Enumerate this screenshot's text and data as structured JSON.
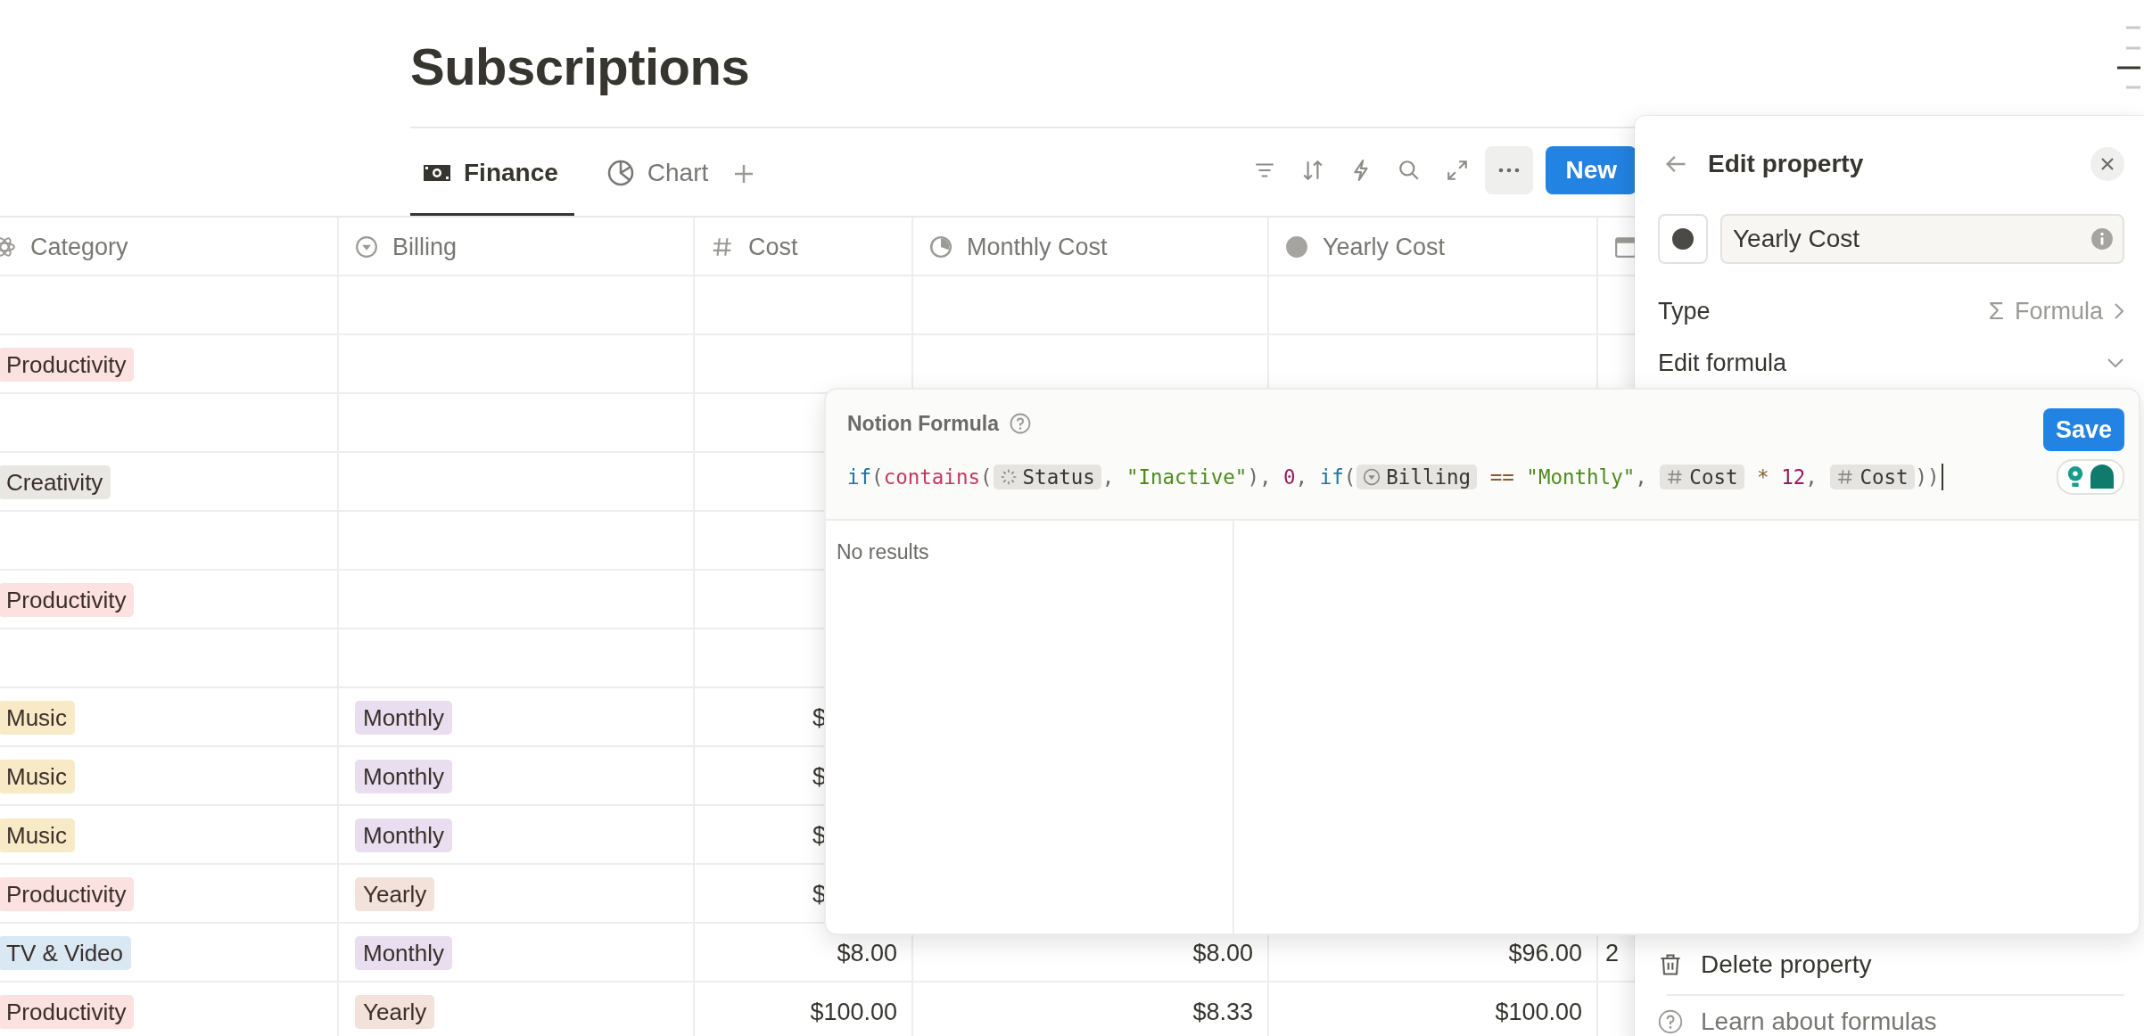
{
  "page": {
    "title": "Subscriptions"
  },
  "tabs": [
    {
      "label": "Finance",
      "kind": "money",
      "selected": true
    },
    {
      "label": "Chart",
      "kind": "chart",
      "selected": false
    }
  ],
  "toolbar": {
    "new_button": "New"
  },
  "table": {
    "columns": [
      {
        "label": "Category",
        "kind": "atom"
      },
      {
        "label": "Billing",
        "kind": "select"
      },
      {
        "label": "Cost",
        "kind": "number"
      },
      {
        "label": "Monthly Cost",
        "kind": "pie"
      },
      {
        "label": "Yearly Cost",
        "kind": "dot"
      },
      {
        "kind": "calendar"
      }
    ],
    "rows": [
      {
        "cells": [
          null,
          null,
          null,
          null,
          null,
          null
        ]
      },
      {
        "cells": [
          {
            "kind": "tag",
            "text": "Productivity",
            "color": "#fbe1df"
          },
          null,
          null,
          null,
          null,
          null
        ]
      },
      {
        "cells": [
          null,
          null,
          null,
          null,
          null,
          null
        ]
      },
      {
        "cells": [
          {
            "kind": "tag",
            "text": "Creativity",
            "color": "#e8e7e4"
          },
          null,
          null,
          null,
          null,
          null
        ]
      },
      {
        "cells": [
          null,
          null,
          null,
          null,
          null,
          null
        ]
      },
      {
        "cells": [
          {
            "kind": "tag",
            "text": "Productivity",
            "color": "#fbe1df"
          },
          null,
          null,
          null,
          null,
          null
        ]
      },
      {
        "cells": [
          null,
          null,
          null,
          null,
          null,
          null
        ]
      },
      {
        "cells": [
          {
            "kind": "tag",
            "text": "Music",
            "color": "#f8eac6"
          },
          {
            "kind": "tag",
            "text": "Monthly",
            "color": "#e8def0"
          },
          {
            "kind": "clipped",
            "text": "$"
          },
          null,
          null,
          null
        ]
      },
      {
        "cells": [
          {
            "kind": "tag",
            "text": "Music",
            "color": "#f8eac6"
          },
          {
            "kind": "tag",
            "text": "Monthly",
            "color": "#e8def0"
          },
          {
            "kind": "clipped",
            "text": "$"
          },
          null,
          null,
          null
        ]
      },
      {
        "cells": [
          {
            "kind": "tag",
            "text": "Music",
            "color": "#f8eac6"
          },
          {
            "kind": "tag",
            "text": "Monthly",
            "color": "#e8def0"
          },
          {
            "kind": "clipped",
            "text": "$"
          },
          null,
          null,
          null
        ]
      },
      {
        "cells": [
          {
            "kind": "tag",
            "text": "Productivity",
            "color": "#fbe1df"
          },
          {
            "kind": "tag",
            "text": "Yearly",
            "color": "#f2e2d9"
          },
          {
            "kind": "clipped",
            "text": "$"
          },
          null,
          null,
          null
        ]
      },
      {
        "cells": [
          {
            "kind": "tag",
            "text": "TV & Video",
            "color": "#d9e8f3"
          },
          {
            "kind": "tag",
            "text": "Monthly",
            "color": "#e8def0"
          },
          {
            "kind": "text",
            "text": "$8.00"
          },
          {
            "kind": "text",
            "text": "$8.00"
          },
          {
            "kind": "text",
            "text": "$96.00"
          },
          {
            "kind": "text",
            "text": "2"
          }
        ]
      },
      {
        "cells": [
          {
            "kind": "tag",
            "text": "Productivity",
            "color": "#fbe1df"
          },
          {
            "kind": "tag",
            "text": "Yearly",
            "color": "#f2e2d9"
          },
          {
            "kind": "text",
            "text": "$100.00"
          },
          {
            "kind": "text",
            "text": "$8.33"
          },
          {
            "kind": "text",
            "text": "$100.00"
          },
          null
        ]
      }
    ]
  },
  "edit_property": {
    "title": "Edit property",
    "name_value": "Yearly Cost",
    "type_label": "Type",
    "type_symbol": "Σ",
    "type_value": "Formula",
    "edit_formula_label": "Edit formula",
    "delete_label": "Delete property",
    "learn_label": "Learn about formulas"
  },
  "formula_editor": {
    "title": "Notion Formula",
    "save_button": "Save",
    "results_text": "No results",
    "tokens": [
      {
        "kind": "keyword",
        "text": "if"
      },
      {
        "kind": "punct",
        "text": "("
      },
      {
        "kind": "function",
        "text": "contains"
      },
      {
        "kind": "punct",
        "text": "("
      },
      {
        "kind": "statusprop",
        "text": "Status"
      },
      {
        "kind": "punct",
        "text": ", "
      },
      {
        "kind": "string",
        "text": "\"Inactive\""
      },
      {
        "kind": "punct",
        "text": "), "
      },
      {
        "kind": "number",
        "text": "0"
      },
      {
        "kind": "punct",
        "text": ", "
      },
      {
        "kind": "keyword",
        "text": "if"
      },
      {
        "kind": "punct",
        "text": "("
      },
      {
        "kind": "selectprop",
        "text": "Billing"
      },
      {
        "kind": "op",
        "text": " == "
      },
      {
        "kind": "string",
        "text": "\"Monthly\""
      },
      {
        "kind": "punct",
        "text": ", "
      },
      {
        "kind": "numberprop",
        "text": "Cost"
      },
      {
        "kind": "op",
        "text": " * "
      },
      {
        "kind": "number",
        "text": "12"
      },
      {
        "kind": "punct",
        "text": ", "
      },
      {
        "kind": "numberprop",
        "text": "Cost"
      },
      {
        "kind": "punct",
        "text": "))"
      }
    ]
  }
}
